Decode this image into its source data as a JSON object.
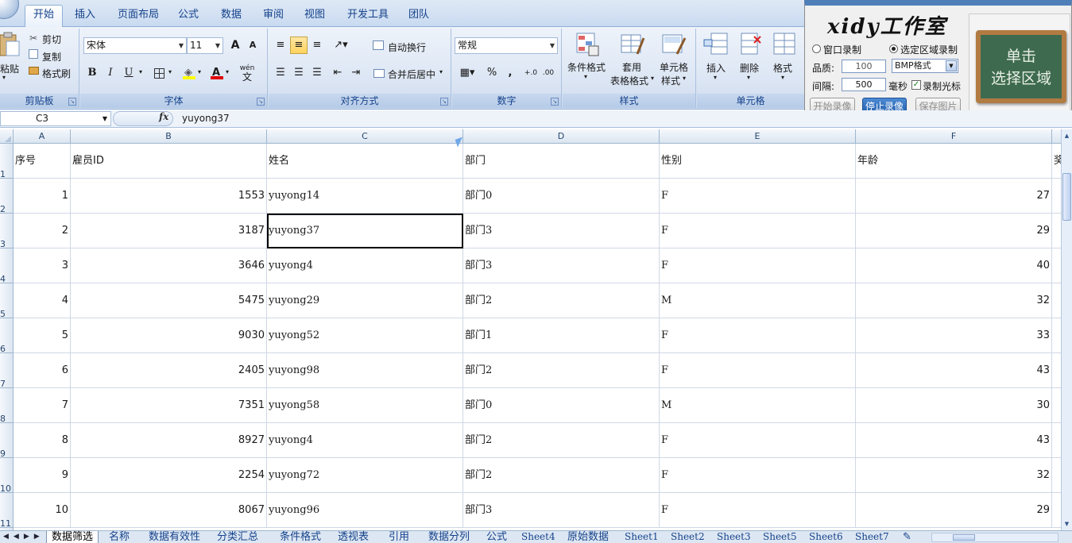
{
  "ribbon": {
    "tabs": [
      "开始",
      "插入",
      "页面布局",
      "公式",
      "数据",
      "审阅",
      "视图",
      "开发工具",
      "团队"
    ],
    "clipboard": {
      "paste": "粘贴",
      "cut": "剪切",
      "copy": "复制",
      "format_painter": "格式刷",
      "label": "剪贴板"
    },
    "font": {
      "name": "宋体",
      "size": "11",
      "label": "字体",
      "bold": "B",
      "italic": "I",
      "underline": "U",
      "grow": "A",
      "shrink": "A",
      "color_a": "A",
      "wen": "wén",
      "wen_char": "文"
    },
    "alignment": {
      "wrap": "自动换行",
      "merge": "合并后居中",
      "label": "对齐方式"
    },
    "number": {
      "format": "常规",
      "percent": "%",
      "comma": ",",
      "label": "数字"
    },
    "styles": {
      "conditional": "条件格式",
      "table_format_1": "套用",
      "table_format_2": "表格格式",
      "cell_styles_1": "单元格",
      "cell_styles_2": "样式",
      "label": "样式"
    },
    "cells": {
      "insert": "插入",
      "delete": "删除",
      "format": "格式",
      "label": "单元格"
    }
  },
  "recorder": {
    "title": "xidy工作室",
    "window_record": "窗口录制",
    "region_record": "选定区域录制",
    "quality_label": "品质:",
    "quality_value": "100",
    "format_value": "BMP格式",
    "interval_label": "间隔:",
    "interval_value": "500",
    "interval_unit": "毫秒",
    "record_cursor": "录制光标",
    "start_btn": "开始录像",
    "stop_btn": "停止录像",
    "save_btn": "保存图片",
    "board_line1": "单击",
    "board_line2": "选择区域"
  },
  "formula_bar": {
    "cell_ref": "C3",
    "fx": "fx",
    "content": "yuyong37"
  },
  "columns": [
    "A",
    "B",
    "C",
    "D",
    "E",
    "F"
  ],
  "row_numbers": [
    "1",
    "2",
    "3",
    "4",
    "5",
    "6",
    "7",
    "8",
    "9",
    "10",
    "11"
  ],
  "headers": [
    "序号",
    "雇员ID",
    "姓名",
    "部门",
    "性别",
    "年龄",
    "奖"
  ],
  "rows": [
    [
      "1",
      "1553",
      "yuyong14",
      "部门0",
      "F",
      "27"
    ],
    [
      "2",
      "3187",
      "yuyong37",
      "部门3",
      "F",
      "29"
    ],
    [
      "3",
      "3646",
      "yuyong4",
      "部门3",
      "F",
      "40"
    ],
    [
      "4",
      "5475",
      "yuyong29",
      "部门2",
      "M",
      "32"
    ],
    [
      "5",
      "9030",
      "yuyong52",
      "部门1",
      "F",
      "33"
    ],
    [
      "6",
      "2405",
      "yuyong98",
      "部门2",
      "F",
      "43"
    ],
    [
      "7",
      "7351",
      "yuyong58",
      "部门0",
      "M",
      "30"
    ],
    [
      "8",
      "8927",
      "yuyong4",
      "部门2",
      "F",
      "43"
    ],
    [
      "9",
      "2254",
      "yuyong72",
      "部门2",
      "F",
      "32"
    ],
    [
      "10",
      "8067",
      "yuyong96",
      "部门3",
      "F",
      "29"
    ]
  ],
  "sheets": [
    "数据筛选",
    "名称",
    "数据有效性",
    "分类汇总",
    "条件格式",
    "透视表",
    "引用",
    "数据分列",
    "公式",
    "Sheet4",
    "原始数据",
    "Sheet1",
    "Sheet2",
    "Sheet3",
    "Sheet5",
    "Sheet6",
    "Sheet7"
  ]
}
